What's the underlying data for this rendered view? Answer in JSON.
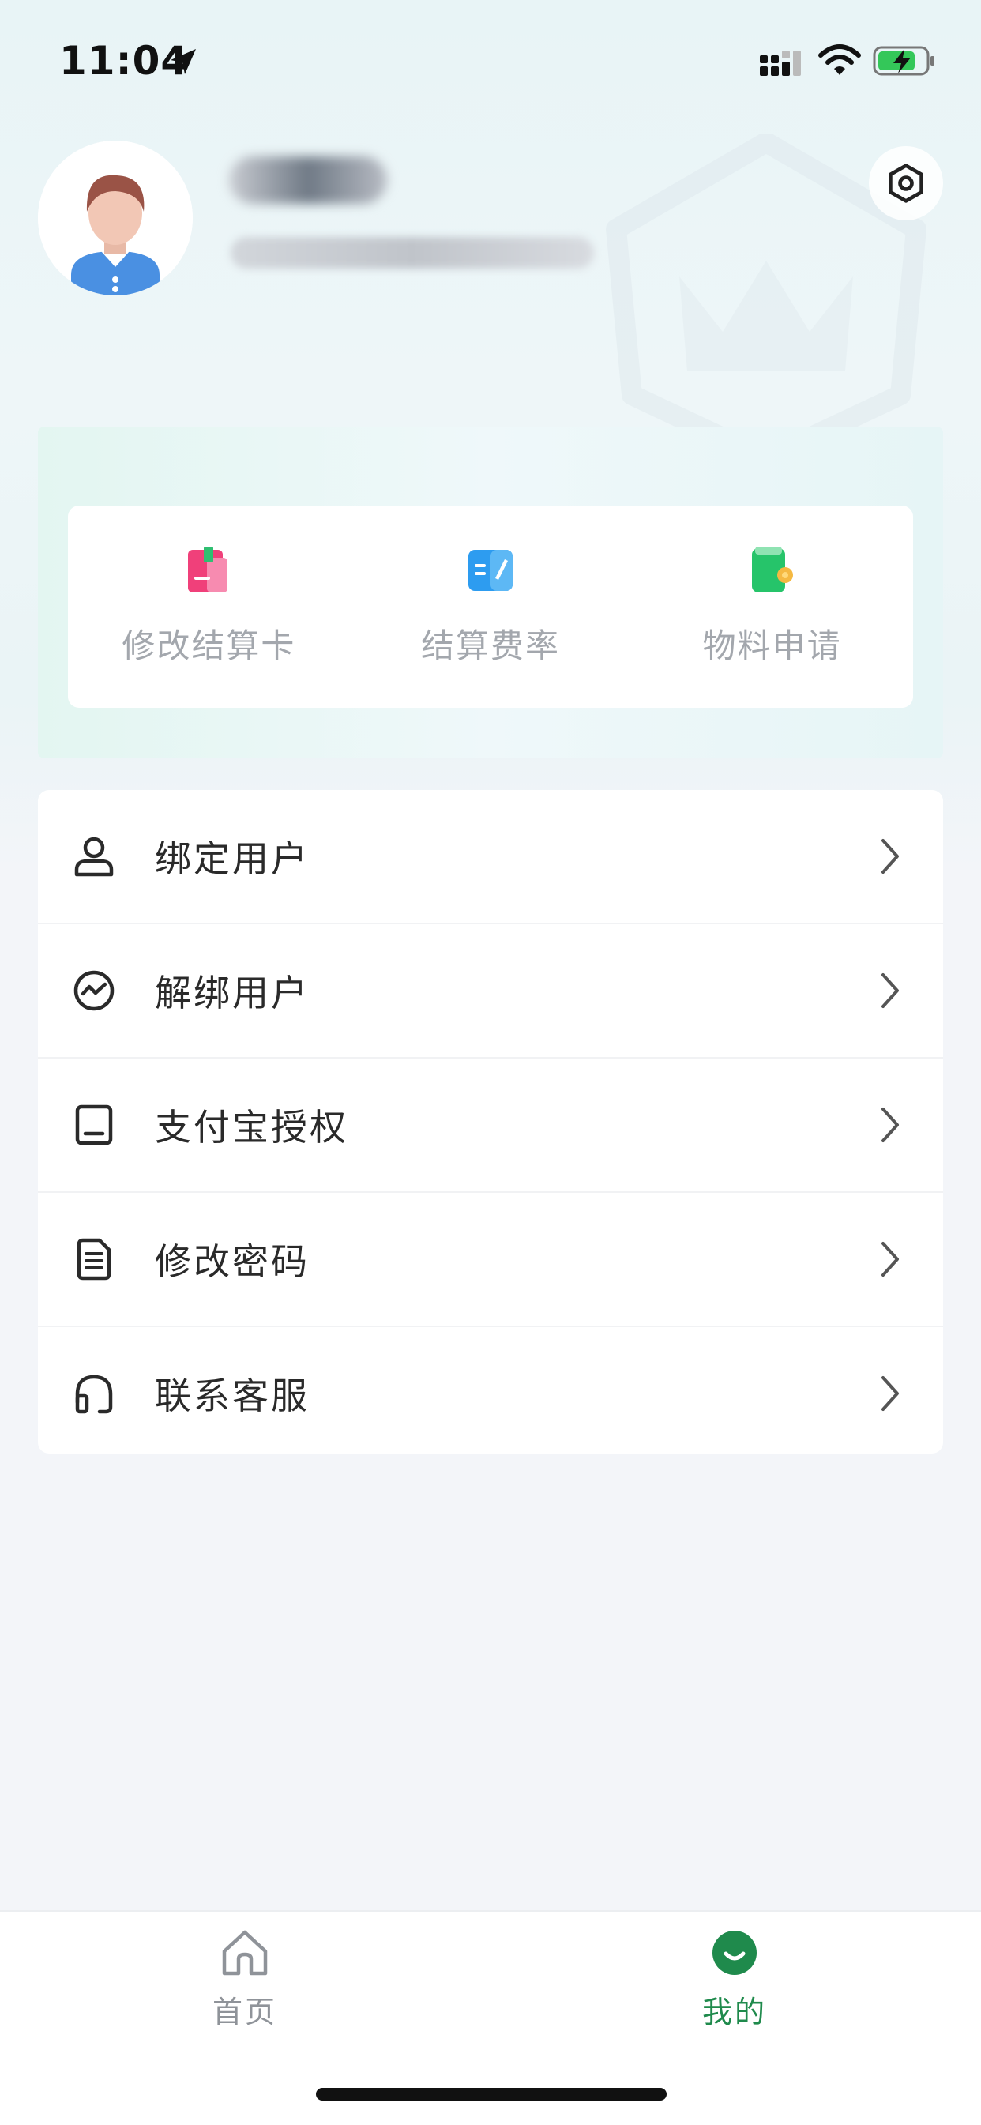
{
  "status_bar": {
    "time": "11:04",
    "icons": [
      "location-arrow-icon",
      "cellular-signal-icon",
      "wifi-icon",
      "battery-charging-icon"
    ]
  },
  "profile": {
    "avatar_icon": "user-avatar-icon",
    "settings_icon": "settings-icon"
  },
  "quick_actions": [
    {
      "label": "修改结算卡",
      "icon": "card-edit-icon",
      "color": "#f0407a"
    },
    {
      "label": "结算费率",
      "icon": "rate-book-icon",
      "color": "#2d9cf0"
    },
    {
      "label": "物料申请",
      "icon": "wallet-icon",
      "color": "#26c46a"
    }
  ],
  "menu": {
    "items": [
      {
        "label": "绑定用户",
        "icon": "user-icon"
      },
      {
        "label": "解绑用户",
        "icon": "trend-circle-icon"
      },
      {
        "label": "支付宝授权",
        "icon": "tablet-icon"
      },
      {
        "label": "修改密码",
        "icon": "document-icon"
      },
      {
        "label": "联系客服",
        "icon": "headset-icon"
      }
    ]
  },
  "tabbar": {
    "tabs": [
      {
        "label": "首页",
        "icon": "home-icon",
        "active": false
      },
      {
        "label": "我的",
        "icon": "mine-smile-icon",
        "active": true
      }
    ],
    "active_color": "#1f8a4c",
    "inactive_color": "#8f9399"
  }
}
